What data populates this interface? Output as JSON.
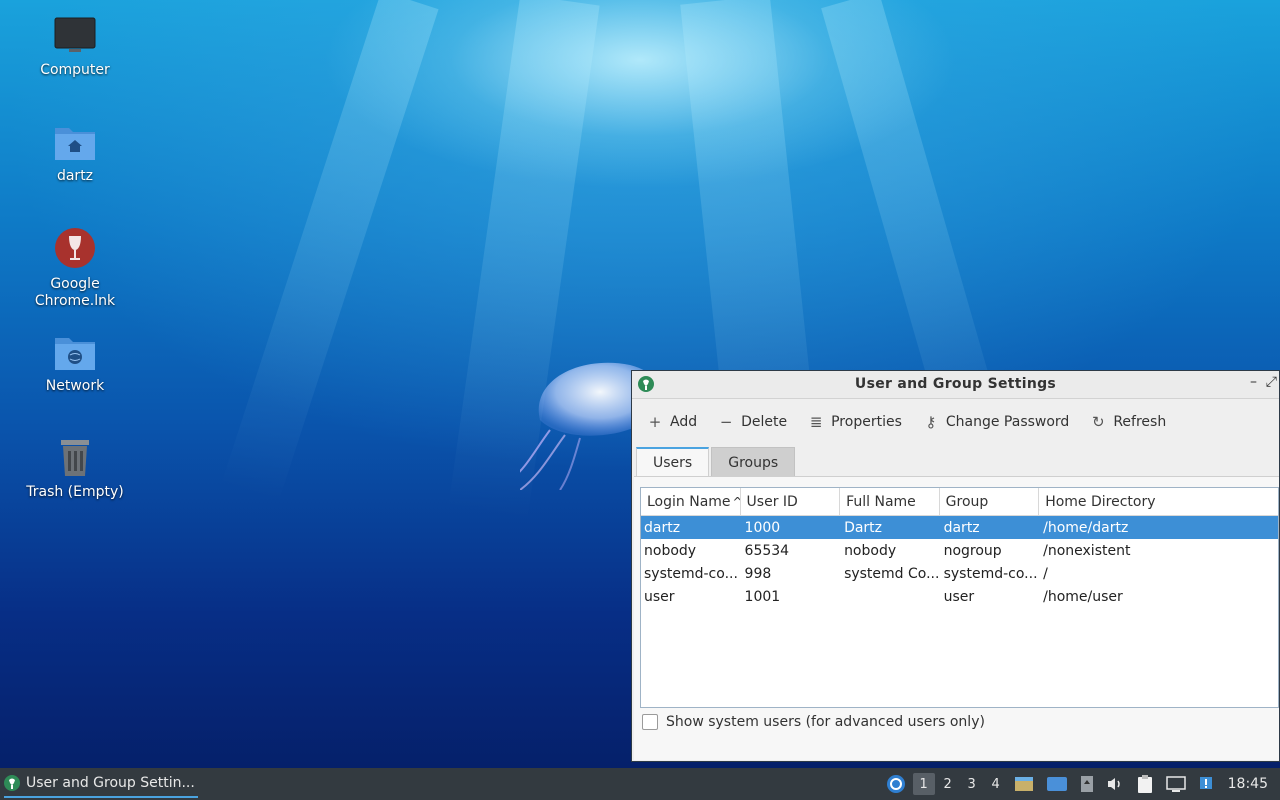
{
  "desktop": {
    "icons": [
      {
        "label": "Computer",
        "icon": "monitor-icon"
      },
      {
        "label": "dartz",
        "icon": "home-folder-icon"
      },
      {
        "label": "Google Chrome.lnk",
        "icon": "wine-glass-icon"
      },
      {
        "label": "Network",
        "icon": "network-folder-icon"
      },
      {
        "label": "Trash (Empty)",
        "icon": "trash-icon"
      }
    ]
  },
  "window": {
    "title": "User and Group Settings",
    "controls": {
      "minimize": "–",
      "maximize": "⤢"
    },
    "toolbar": {
      "add": "Add",
      "delete": "Delete",
      "properties": "Properties",
      "change_password": "Change Password",
      "refresh": "Refresh"
    },
    "tabs": [
      {
        "label": "Users",
        "active": true
      },
      {
        "label": "Groups",
        "active": false
      }
    ],
    "table": {
      "columns": [
        "Login Name",
        "User ID",
        "Full Name",
        "Group",
        "Home Directory"
      ],
      "sort_column": "Login Name",
      "sort_indicator": "^",
      "rows": [
        {
          "login": "dartz",
          "uid": "1000",
          "fullname": "Dartz",
          "group": "dartz",
          "home": "/home/dartz",
          "selected": true
        },
        {
          "login": "nobody",
          "uid": "65534",
          "fullname": "nobody",
          "group": "nogroup",
          "home": "/nonexistent",
          "selected": false
        },
        {
          "login": "systemd-co...",
          "uid": "998",
          "fullname": "systemd Co...",
          "group": "systemd-co...",
          "home": "/",
          "selected": false
        },
        {
          "login": "user",
          "uid": "1001",
          "fullname": "",
          "group": "user",
          "home": "/home/user",
          "selected": false
        }
      ]
    },
    "show_system_users": {
      "label": "Show system users (for advanced users only)",
      "checked": false
    }
  },
  "taskbar": {
    "active_task": "User and Group Settin...",
    "workspaces": [
      "1",
      "2",
      "3",
      "4"
    ],
    "active_workspace": "1",
    "clock": "18:45"
  },
  "colors": {
    "accent": "#4aa3e0",
    "selection": "#3d8fd6",
    "taskbar": "#333a40"
  }
}
